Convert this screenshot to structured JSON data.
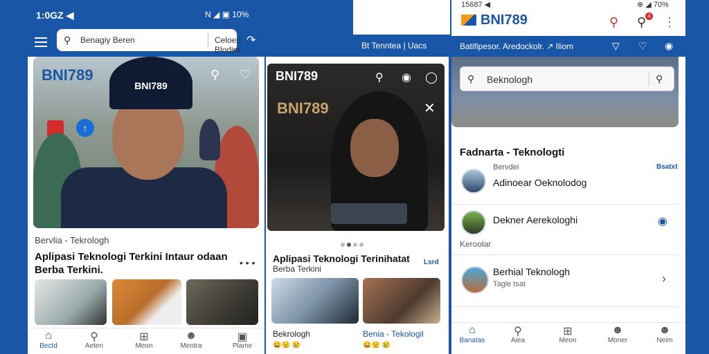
{
  "left": {
    "status": {
      "time": "1:0GZ ◀",
      "icons": "N ◢ ▣ 10%"
    },
    "search": {
      "placeholder": "Benagiy Beren",
      "dropdown": "Celoen Blodira"
    },
    "hero_brand": "BNI789",
    "cap_text": "BNI789",
    "category": "Bervlia - Tekrologh",
    "headline": "Aplipasi Teknologi Terkini Intaur odaan Berba Terkini.",
    "more": "• • •",
    "nav": [
      {
        "label": "Bectd",
        "icon": "home-icon"
      },
      {
        "label": "Aeten",
        "icon": "search-icon"
      },
      {
        "label": "Meon",
        "icon": "plus-icon"
      },
      {
        "label": "Mentra",
        "icon": "user-icon"
      },
      {
        "label": "Plame",
        "icon": "tray-icon"
      }
    ]
  },
  "middle": {
    "topbar": "Bt Tenntea  |  Uacs",
    "hero_brand": "BNI789",
    "hero_brand2": "BNI789",
    "headline": "Aplipasi Teknologi Terinihatat",
    "headline2": "Berba Terkini",
    "more": "Lsrd",
    "caption1": "Bekrologh",
    "caption2": "Benia - Tekologil",
    "emoji1": "😀😟 😢",
    "emoji2": "😀😟 😢"
  },
  "right": {
    "status_left": "15687 ◀",
    "status_right": "⊕ ◢ 70%",
    "logo": "BNI789",
    "notif_count": "4",
    "tabs_text": "Batifipesor.  Aredockolr.  ↗ Iliom",
    "search_placeholder": "Beknologh",
    "section_title": "Fadnarta - Teknologti",
    "section_sub": "Bervdei",
    "section_link": "Bsatxt",
    "items": [
      {
        "label": "Adinoear Oeknolodog",
        "sub": ""
      },
      {
        "label": "Dekner Aerekologhi",
        "sub": ""
      },
      {
        "label": "Berhial Teknologh",
        "sub": "Tagle tsat"
      }
    ],
    "kero": "Keroolar",
    "nav": [
      {
        "label": "Banatas",
        "icon": "home-icon"
      },
      {
        "label": "Aiea",
        "icon": "search-icon"
      },
      {
        "label": "Meon",
        "icon": "plus-icon"
      },
      {
        "label": "Moner",
        "icon": "user-icon"
      },
      {
        "label": "Neim",
        "icon": "profile-icon"
      }
    ]
  },
  "colors": {
    "brand_blue": "#1a56a8",
    "accent_red": "#d62b2b",
    "accent_orange": "#f39c1e"
  }
}
